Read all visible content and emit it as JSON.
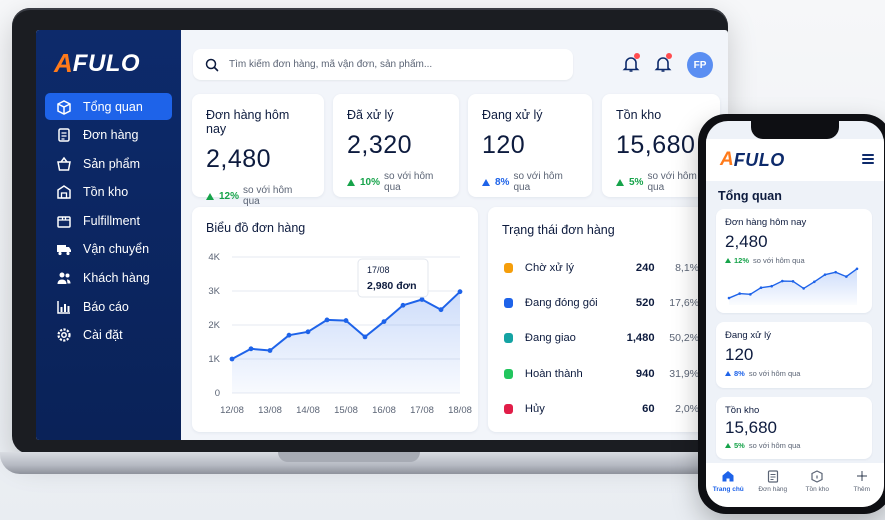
{
  "brand": {
    "logo_letter": "A",
    "logo_rest": "FULO",
    "accent": "#1e63e9",
    "logo_accent": "#ff7a1a",
    "sidebar_bg": "#0d2a6b"
  },
  "sidebar": {
    "items": [
      {
        "label": "Tổng quan",
        "icon": "dashboard-box-icon",
        "active": true
      },
      {
        "label": "Đơn hàng",
        "icon": "document-icon"
      },
      {
        "label": "Sản phẩm",
        "icon": "basket-icon"
      },
      {
        "label": "Tồn kho",
        "icon": "warehouse-icon"
      },
      {
        "label": "Fulfillment",
        "icon": "box-icon"
      },
      {
        "label": "Vận chuyển",
        "icon": "truck-icon"
      },
      {
        "label": "Khách hàng",
        "icon": "users-icon"
      },
      {
        "label": "Báo cáo",
        "icon": "bar-chart-icon"
      },
      {
        "label": "Cài đặt",
        "icon": "gear-icon"
      }
    ]
  },
  "topbar": {
    "search_placeholder": "Tìm kiếm đơn hàng, mã vận đơn, sản phẩm...",
    "avatar_initials": "FP"
  },
  "stats": [
    {
      "title": "Đơn hàng hôm nay",
      "value": "2,480",
      "delta": "12%",
      "note": "so với hôm qua",
      "color": "#16a34a"
    },
    {
      "title": "Đã xử lý",
      "value": "2,320",
      "delta": "10%",
      "note": "so với hôm qua",
      "color": "#16a34a"
    },
    {
      "title": "Đang xử lý",
      "value": "120",
      "delta": "8%",
      "note": "so với hôm qua",
      "color": "#1e63e9"
    },
    {
      "title": "Tồn kho",
      "value": "15,680",
      "delta": "5%",
      "note": "so với hôm qua",
      "color": "#16a34a"
    }
  ],
  "chart_title": "Biểu đồ đơn hàng",
  "chart_data": {
    "type": "area",
    "x": [
      "12/08",
      "",
      "13/08",
      "",
      "14/08",
      "",
      "15/08",
      "",
      "16/08",
      "",
      "17/08",
      "",
      "18/08"
    ],
    "xticks": [
      "12/08",
      "13/08",
      "14/08",
      "15/08",
      "16/08",
      "17/08",
      "18/08"
    ],
    "values": [
      1000,
      1300,
      1250,
      1700,
      1800,
      2150,
      2130,
      1650,
      2100,
      2580,
      2750,
      2450,
      2980
    ],
    "yticks": [
      "0",
      "1K",
      "2K",
      "3K",
      "4K"
    ],
    "ylim": [
      0,
      4000
    ],
    "tooltip": {
      "date": "17/08",
      "value": "2,980 đơn"
    }
  },
  "status": {
    "title": "Trạng thái đơn hàng",
    "rows": [
      {
        "label": "Chờ xử lý",
        "count": "240",
        "pct": "8,1%",
        "color": "#f59e0b"
      },
      {
        "label": "Đang đóng gói",
        "count": "520",
        "pct": "17,6%",
        "color": "#1e63e9"
      },
      {
        "label": "Đang giao",
        "count": "1,480",
        "pct": "50,2%",
        "color": "#14a3a3"
      },
      {
        "label": "Hoàn thành",
        "count": "940",
        "pct": "31,9%",
        "color": "#22c55e"
      },
      {
        "label": "Hủy",
        "count": "60",
        "pct": "2,0%",
        "color": "#e11d48"
      }
    ]
  },
  "phone": {
    "title": "Tổng quan",
    "cards": [
      {
        "title": "Đơn hàng hôm nay",
        "value": "2,480",
        "delta": "12%",
        "note": "so với hôm qua",
        "color": "#16a34a"
      },
      {
        "title": "Đang xử lý",
        "value": "120",
        "delta": "8%",
        "note": "so với hôm qua",
        "color": "#1e63e9"
      },
      {
        "title": "Tồn kho",
        "value": "15,680",
        "delta": "5%",
        "note": "so với hôm qua",
        "color": "#16a34a"
      }
    ],
    "tabs": [
      {
        "label": "Trang chủ",
        "icon": "home-icon",
        "active": true
      },
      {
        "label": "Đơn hàng",
        "icon": "clipboard-icon"
      },
      {
        "label": "Tồn kho",
        "icon": "box-icon"
      },
      {
        "label": "Thêm",
        "icon": "more-icon"
      }
    ]
  }
}
